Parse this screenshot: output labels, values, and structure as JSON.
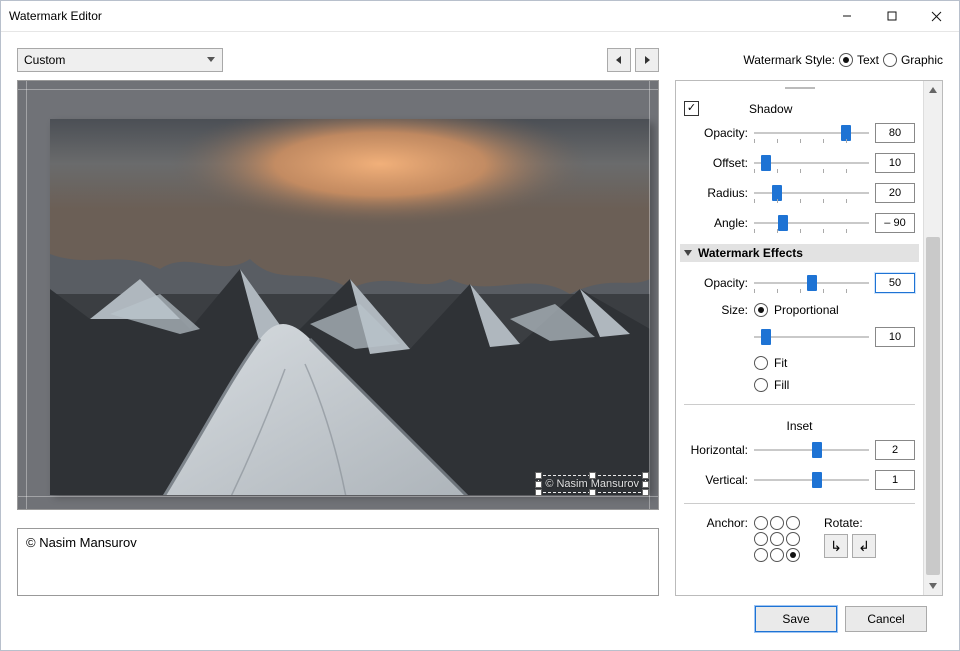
{
  "window": {
    "title": "Watermark Editor"
  },
  "preset": {
    "label": "Custom"
  },
  "styleRow": {
    "label": "Watermark Style:",
    "text": "Text",
    "graphic": "Graphic",
    "selected": "text"
  },
  "editor": {
    "text": "© Nasim Mansurov"
  },
  "preview": {
    "watermark_text": "© Nasim Mansurov"
  },
  "shadow": {
    "header": "Shadow",
    "enabled": true,
    "opacity": {
      "label": "Opacity:",
      "value": 80,
      "pct": 80
    },
    "offset": {
      "label": "Offset:",
      "value": 10,
      "pct": 10
    },
    "radius": {
      "label": "Radius:",
      "value": 20,
      "pct": 20
    },
    "angle": {
      "label": "Angle:",
      "value": "– 90",
      "pct": 25
    }
  },
  "effects": {
    "header": "Watermark Effects",
    "opacity": {
      "label": "Opacity:",
      "value": 50,
      "pct": 50
    },
    "size_label": "Size:",
    "size_mode": "proportional",
    "size_options": {
      "proportional": "Proportional",
      "fit": "Fit",
      "fill": "Fill"
    },
    "size_slider": {
      "value": 10,
      "pct": 10
    },
    "inset_header": "Inset",
    "horizontal": {
      "label": "Horizontal:",
      "value": 2,
      "pct": 55
    },
    "vertical": {
      "label": "Vertical:",
      "value": 1,
      "pct": 55
    },
    "anchor_label": "Anchor:",
    "anchor_index": 8,
    "rotate_label": "Rotate:"
  },
  "footer": {
    "save": "Save",
    "cancel": "Cancel"
  }
}
